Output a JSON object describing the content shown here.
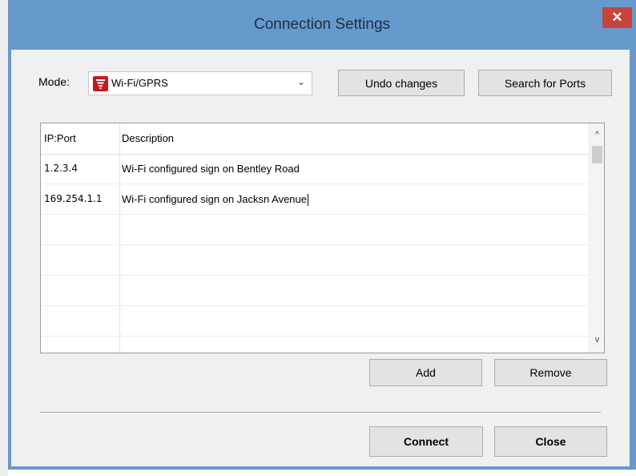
{
  "window": {
    "title": "Connection Settings",
    "close_glyph": "✕"
  },
  "mode": {
    "label": "Mode:",
    "selected": "Wi-Fi/GPRS",
    "icon": "wifi-signal-icon",
    "chevron": "⌄"
  },
  "toolbar": {
    "undo_label": "Undo changes",
    "search_label": "Search for Ports"
  },
  "table": {
    "columns": [
      "IP:Port",
      "Description"
    ],
    "rows": [
      {
        "ip": "1.2.3.4",
        "description": "Wi-Fi configured sign on Bentley Road"
      },
      {
        "ip": "169.254.1.1",
        "description": "Wi-Fi configured sign on Jacksn Avenue"
      }
    ],
    "scroll_up": "^",
    "scroll_down": "v"
  },
  "actions": {
    "add_label": "Add",
    "remove_label": "Remove"
  },
  "footer": {
    "connect_label": "Connect",
    "close_label": "Close"
  },
  "colors": {
    "titlebar": "#6699cc",
    "close": "#c7443b",
    "icon": "#c41a1a"
  }
}
